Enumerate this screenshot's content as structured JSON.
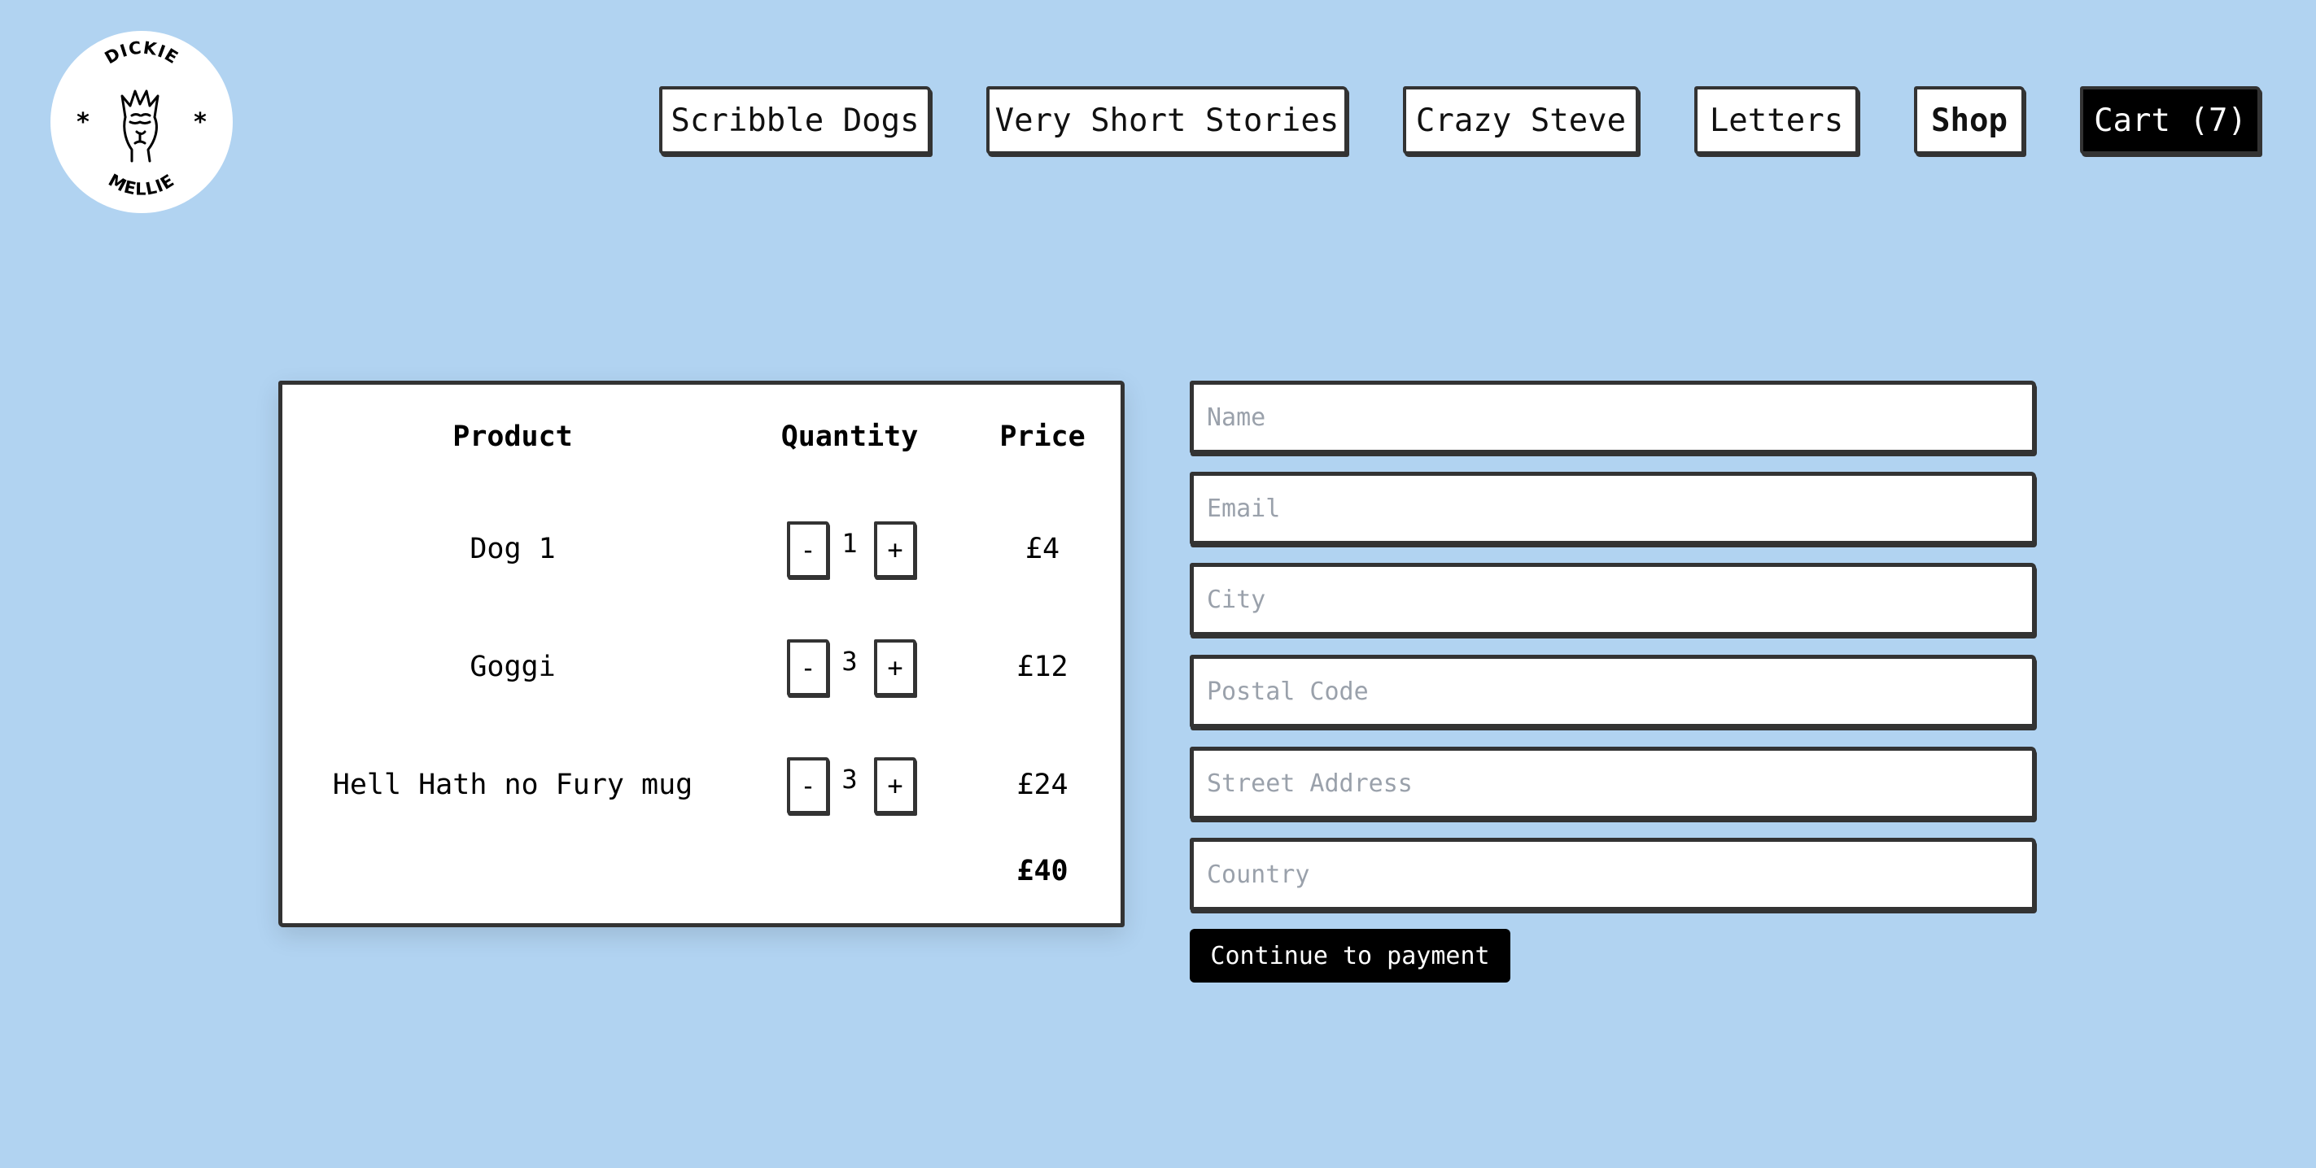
{
  "logo": {
    "alt": "Dickie Mellie logo",
    "top_text": "DICKIE",
    "bottom_text": "MELLIE"
  },
  "nav": {
    "items": [
      {
        "label": "Scribble Dogs"
      },
      {
        "label": "Very Short Stories"
      },
      {
        "label": "Crazy Steve"
      },
      {
        "label": "Letters"
      },
      {
        "label": "Shop"
      }
    ],
    "cart_label": "Cart (7)"
  },
  "cart": {
    "headers": {
      "product": "Product",
      "quantity": "Quantity",
      "price": "Price"
    },
    "rows": [
      {
        "product": "Dog 1",
        "quantity": "1",
        "price": "£4"
      },
      {
        "product": "Goggi",
        "quantity": "3",
        "price": "£12"
      },
      {
        "product": "Hell Hath no Fury mug",
        "quantity": "3",
        "price": "£24"
      }
    ],
    "decrement_label": "-",
    "increment_label": "+",
    "total": "£40"
  },
  "form": {
    "name_placeholder": "Name",
    "email_placeholder": "Email",
    "city_placeholder": "City",
    "postal_placeholder": "Postal Code",
    "street_placeholder": "Street Address",
    "country_placeholder": "Country",
    "submit_label": "Continue to payment"
  },
  "colors": {
    "page_background": "#b1d3f1",
    "border": "#333333",
    "cart_button": "#000000",
    "primary_button": "#000000",
    "placeholder_text": "#9aa1ab"
  }
}
